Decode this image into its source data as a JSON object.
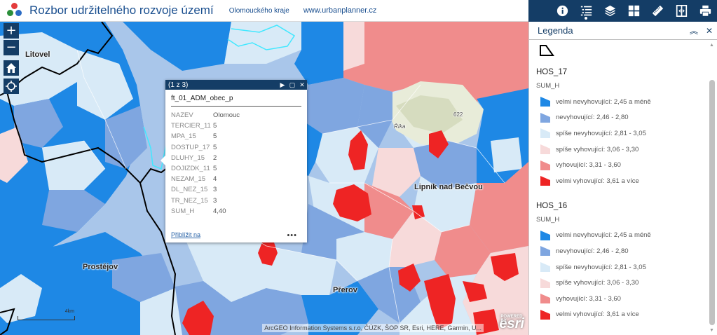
{
  "header": {
    "title": "Rozbor udržitelného rozvoje území",
    "subtitle": "Olomouckého kraje",
    "link": "www.urbanplanner.cz",
    "logo_colors": [
      "#e33b3b",
      "#2b8f3a",
      "#2a6bc4"
    ]
  },
  "toolbar": {
    "tools": [
      {
        "name": "about-tool",
        "icon": "info-icon"
      },
      {
        "name": "legend-tool",
        "icon": "list-icon",
        "active": true
      },
      {
        "name": "layers-tool",
        "icon": "layers-icon"
      },
      {
        "name": "basemap-tool",
        "icon": "grid-icon"
      },
      {
        "name": "measure-tool",
        "icon": "ruler-icon"
      },
      {
        "name": "swipe-tool",
        "icon": "swipe-icon"
      },
      {
        "name": "print-tool",
        "icon": "printer-icon"
      }
    ]
  },
  "map": {
    "zoom_in": "+",
    "zoom_out": "−",
    "places": [
      "Litovel",
      "Prostějov",
      "Přerov",
      "Lipník nad Bečvou",
      "Říka",
      "622"
    ],
    "attribution": "ArcGEO Information Systems s.r.o, ČÚZK, ŠOP SR, Esri, HERE, Garmin, U...",
    "esri_label": "esri",
    "esri_powered": "POWERED BY",
    "scale_label": "4km"
  },
  "popup": {
    "count": "(1 z 3)",
    "layer": "ft_01_ADM_obec_p",
    "rows": [
      {
        "k": "NAZEV",
        "v": "Olomouc"
      },
      {
        "k": "TERCIER_11",
        "v": "5"
      },
      {
        "k": "MPA_15",
        "v": "5"
      },
      {
        "k": "DOSTUP_17",
        "v": "5"
      },
      {
        "k": "DLUHY_15",
        "v": "2"
      },
      {
        "k": "DOJIZDK_11",
        "v": "5"
      },
      {
        "k": "NEZAM_15",
        "v": "4"
      },
      {
        "k": "DL_NEZ_15",
        "v": "3"
      },
      {
        "k": "TR_NEZ_15",
        "v": "3"
      },
      {
        "k": "SUM_H",
        "v": "4,40"
      }
    ],
    "zoom_link": "Přiblížit na",
    "more": "•••"
  },
  "legend": {
    "title": "Legenda",
    "layers": [
      {
        "name": "HOS_17",
        "field": "SUM_H",
        "items": [
          {
            "label": "velmi nevyhovující: 2,45 a méně",
            "color": "#1e88e5",
            "shape": "tri"
          },
          {
            "label": "nevyhovující: 2,46 - 2,80",
            "color": "#7fa6e0",
            "shape": "tri"
          },
          {
            "label": "spíše nevyhovující: 2,81 - 3,05",
            "color": "#d8eaf7",
            "shape": "tri"
          },
          {
            "label": "spíše vyhovující: 3,06 - 3,30",
            "color": "#f7dada",
            "shape": "tri"
          },
          {
            "label": "vyhovující: 3,31 - 3,60",
            "color": "#f08c8c",
            "shape": "tri"
          },
          {
            "label": "velmi vyhovující: 3,61 a více",
            "color": "#ee2424",
            "shape": "tri"
          }
        ]
      },
      {
        "name": "HOS_16",
        "field": "SUM_H",
        "items": [
          {
            "label": "velmi nevyhovující: 2,45 a méně",
            "color": "#1e88e5",
            "shape": "tri"
          },
          {
            "label": "nevyhovující: 2,46 - 2,80",
            "color": "#7fa6e0",
            "shape": "tri"
          },
          {
            "label": "spíše nevyhovující: 2,81 - 3,05",
            "color": "#d8eaf7",
            "shape": "tri"
          },
          {
            "label": "spíše vyhovující: 3,06 - 3,30",
            "color": "#f7dada",
            "shape": "tri"
          },
          {
            "label": "vyhovující: 3,31 - 3,60",
            "color": "#f08c8c",
            "shape": "tri"
          },
          {
            "label": "velmi vyhovující: 3,61 a více",
            "color": "#ee2424",
            "shape": "tri"
          }
        ]
      }
    ]
  }
}
